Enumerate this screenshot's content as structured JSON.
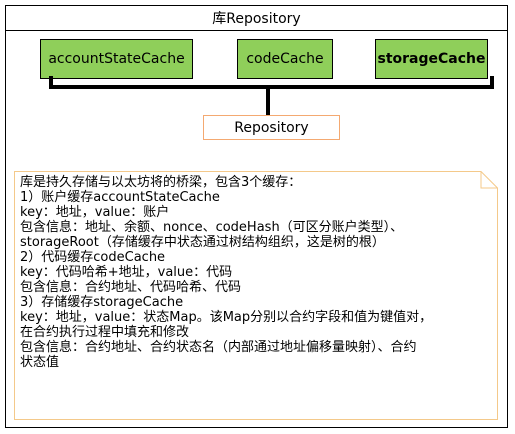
{
  "container": {
    "title": "库Repository"
  },
  "caches": {
    "account": "accountStateCache",
    "code": "codeCache",
    "storage": "storageCache"
  },
  "repository": {
    "label": "Repository"
  },
  "note": {
    "lines": [
      "库是持久存储与以太坊将的桥梁，包含3个缓存：",
      "1）账户缓存accountStateCache",
      "key：地址，value：账户",
      "包含信息：地址、余额、nonce、codeHash（可区分账户类型）、",
      "storageRoot（存储缓存中状态通过树结构组织，这是树的根）",
      "2）代码缓存codeCache",
      "key：代码哈希+地址，value：代码",
      "包含信息：合约地址、代码哈希、代码",
      "3）存储缓存storageCache",
      "key：地址，value：状态Map。该Map分别以合约字段和值为键值对，",
      "在合约执行过程中填充和修改",
      "包含信息：合约地址、合约状态名（内部通过地址偏移量映射）、合约",
      "状态值"
    ]
  },
  "colors": {
    "cache_fill": "#8fcf5a",
    "repository_border": "#f4a971",
    "note_border": "#f4c98a"
  }
}
